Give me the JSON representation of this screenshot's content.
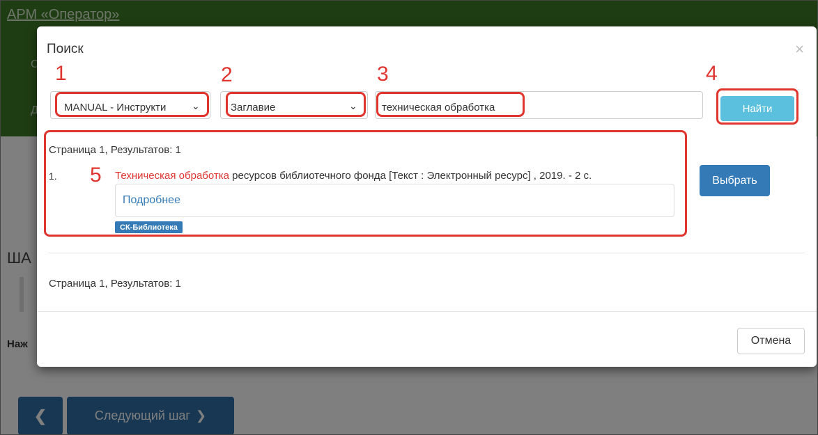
{
  "app": {
    "title": "АРМ «Оператор»",
    "nav_1": "С",
    "nav_2": "Д",
    "step_heading": "ША",
    "hint": "Наж",
    "prev_label": "❮",
    "next_label": "Следующий шаг",
    "next_chevron": "❯"
  },
  "modal": {
    "title": "Поиск",
    "close_label": "×",
    "database_select": {
      "value": "MANUAL - Инструкти"
    },
    "field_select": {
      "value": "Заглавие"
    },
    "search_input": {
      "value": "техническая обработка"
    },
    "find_label": "Найти",
    "results_info": "Страница 1, Результатов: 1",
    "results": [
      {
        "index": "1.",
        "title_highlight": "Техническая обработка",
        "title_rest": " ресурсов библиотечного фонда [Текст : Электронный ресурс] , 2019. - 2 с.",
        "details_label": "Подробнее",
        "badge": "СК-Библиотека",
        "select_label": "Выбрать"
      }
    ],
    "results_info_bottom": "Страница 1, Результатов: 1",
    "cancel_label": "Отмена"
  },
  "annotations": [
    "1",
    "2",
    "3",
    "4",
    "5"
  ],
  "colors": {
    "header_green": "#3f7a26",
    "annotation_red": "#e0342e",
    "primary_blue": "#337ab7",
    "info_button": "#5bc0de"
  }
}
